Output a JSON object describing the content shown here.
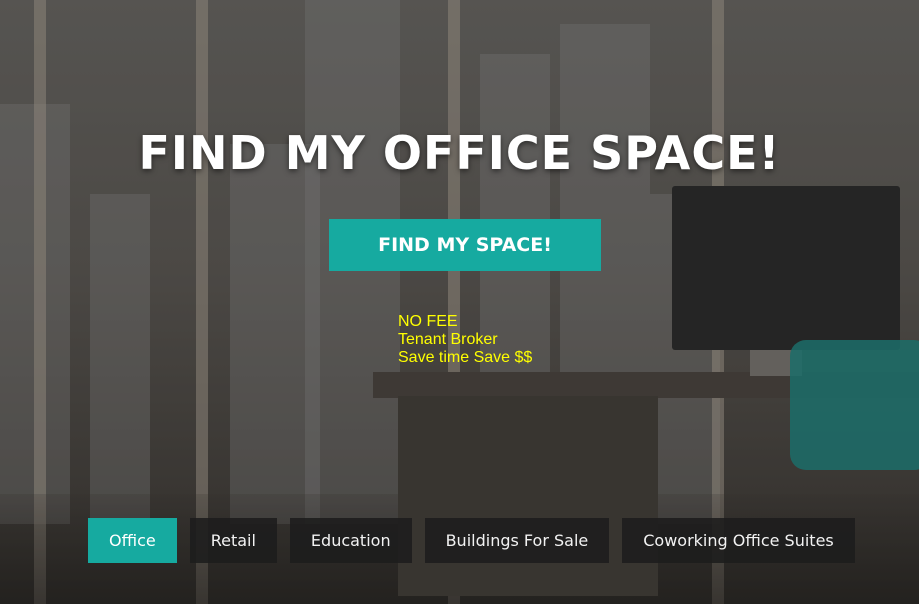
{
  "hero": {
    "title": "FIND MY OFFICE SPACE!",
    "cta_label": "FIND MY SPACE!",
    "promo_lines": [
      "NO FEE",
      "Tenant Broker",
      "Save time Save $$"
    ]
  },
  "tabs": [
    {
      "label": "Office",
      "active": true
    },
    {
      "label": "Retail",
      "active": false
    },
    {
      "label": "Education",
      "active": false
    },
    {
      "label": "Buildings For Sale",
      "active": false
    },
    {
      "label": "Coworking Office Suites",
      "active": false
    }
  ],
  "colors": {
    "accent": "#16aaa0",
    "promo_text": "#ffff00",
    "tab_bg": "#1c1c1c",
    "title_text": "#ffffff"
  }
}
